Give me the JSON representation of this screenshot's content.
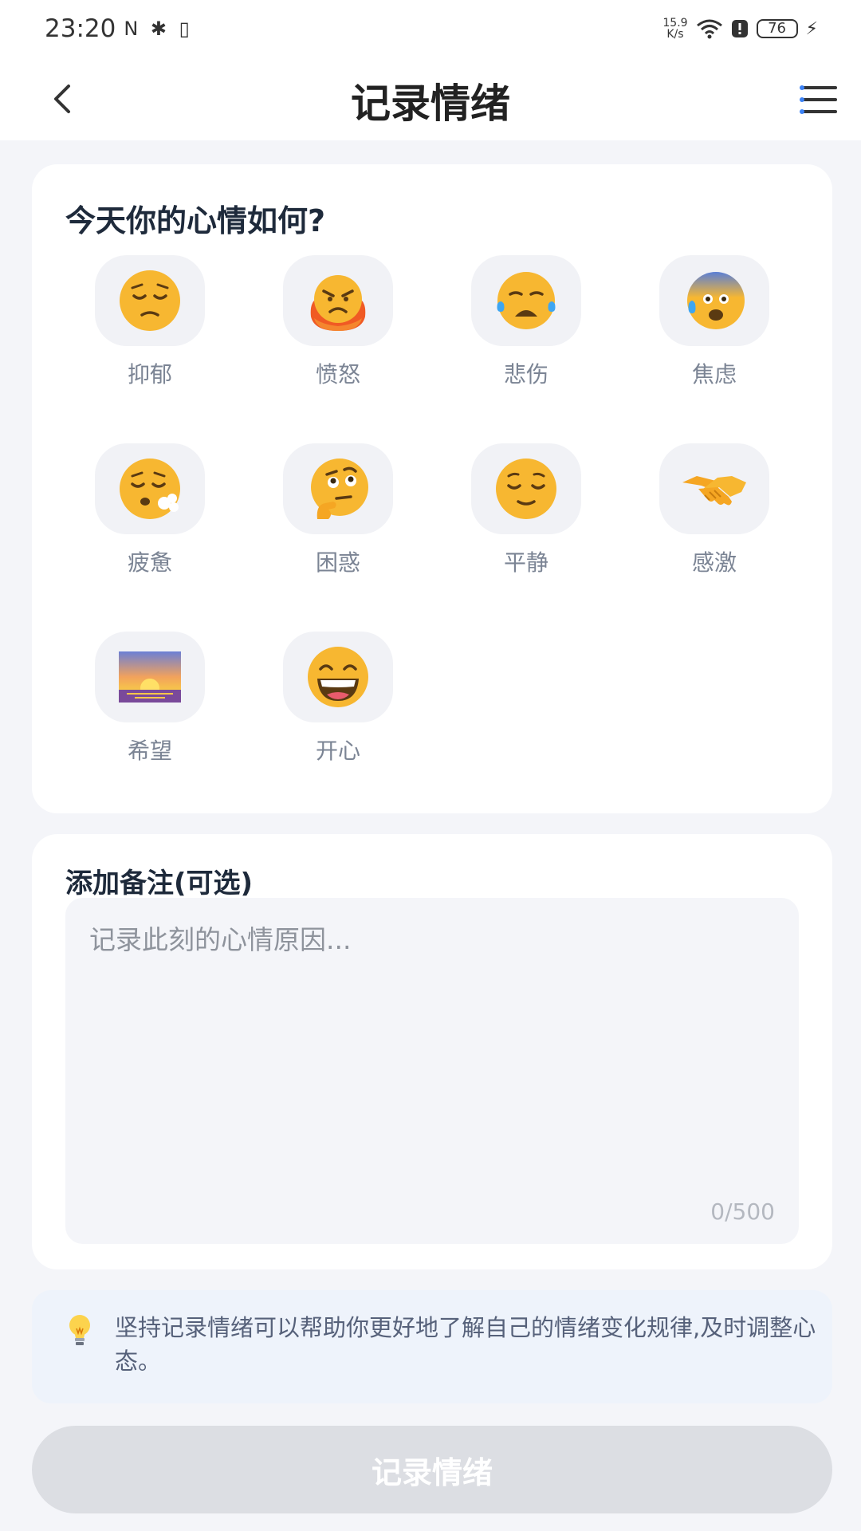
{
  "status_bar": {
    "time": "23:20",
    "left_icons": "N ✱ ▯",
    "net_speed_value": "15.9",
    "net_speed_unit": "K/s",
    "battery": "76"
  },
  "header": {
    "title": "记录情绪",
    "back_icon": "chevron-left-icon",
    "menu_icon": "menu-icon"
  },
  "mood_section": {
    "title": "今天你的心情如何?",
    "moods": [
      {
        "label": "抑郁",
        "icon": "pensive-face-icon"
      },
      {
        "label": "愤怒",
        "icon": "angry-fire-face-icon"
      },
      {
        "label": "悲伤",
        "icon": "crying-face-icon"
      },
      {
        "label": "焦虑",
        "icon": "anxious-sweat-face-icon"
      },
      {
        "label": "疲惫",
        "icon": "exhaling-face-icon"
      },
      {
        "label": "困惑",
        "icon": "thinking-face-icon"
      },
      {
        "label": "平静",
        "icon": "relieved-face-icon"
      },
      {
        "label": "感激",
        "icon": "handshake-icon"
      },
      {
        "label": "希望",
        "icon": "sunrise-icon"
      },
      {
        "label": "开心",
        "icon": "grinning-face-icon"
      }
    ]
  },
  "note_section": {
    "title": "添加备注(可选)",
    "placeholder": "记录此刻的心情原因...",
    "counter": "0/500"
  },
  "tip": {
    "icon": "light-bulb-icon",
    "text": "坚持记录情绪可以帮助你更好地了解自己的情绪变化规律,及时调整心态。"
  },
  "submit": {
    "label": "记录情绪"
  },
  "colors": {
    "background": "#f4f5f9",
    "card": "#ffffff",
    "tip_background": "#eef3fb",
    "button_disabled": "#dcdee3",
    "emoji_yellow": "#f7b731",
    "menu_accent": "#3b82f6"
  }
}
